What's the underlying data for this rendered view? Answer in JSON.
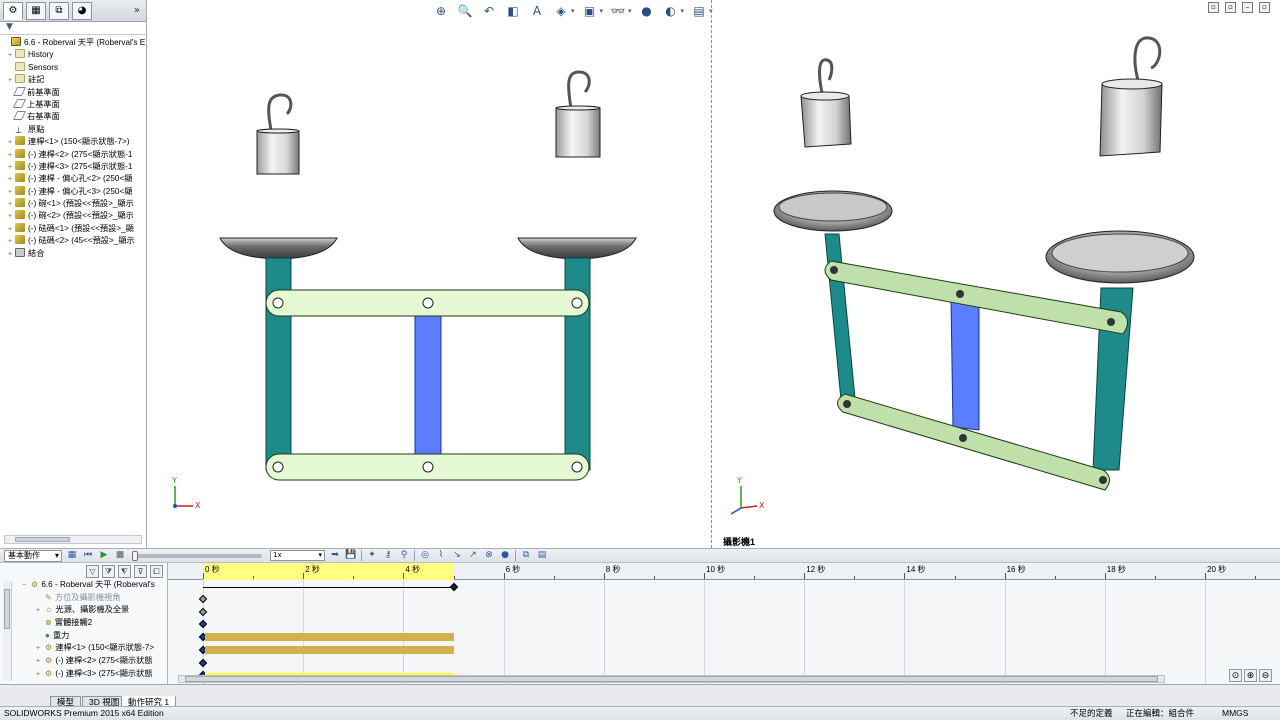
{
  "left_panel": {
    "tabs": [
      "feature-manager",
      "property-manager",
      "configuration-manager",
      "display-manager"
    ],
    "expand_glyph": "»",
    "filter_glyph": "▼",
    "tree": [
      {
        "label": "6.6 - Roberval 天平 (Roberval's E",
        "icon": "asm",
        "exp": "",
        "indent": 0
      },
      {
        "label": "History",
        "icon": "folder",
        "exp": "+",
        "indent": 1
      },
      {
        "label": "Sensors",
        "icon": "folder",
        "exp": "",
        "indent": 1
      },
      {
        "label": "註記",
        "icon": "folder",
        "exp": "+",
        "indent": 1
      },
      {
        "label": "前基準面",
        "icon": "plane",
        "exp": "",
        "indent": 1
      },
      {
        "label": "上基準面",
        "icon": "plane",
        "exp": "",
        "indent": 1
      },
      {
        "label": "右基準面",
        "icon": "plane",
        "exp": "",
        "indent": 1
      },
      {
        "label": "原點",
        "icon": "origin",
        "exp": "",
        "indent": 1
      },
      {
        "label": "連桿<1> (150<顯示狀態-7>)",
        "icon": "part",
        "exp": "+",
        "indent": 1
      },
      {
        "label": "(-) 連桿<2> (275<顯示狀態-1",
        "icon": "part",
        "exp": "+",
        "indent": 1
      },
      {
        "label": "(-) 連桿<3> (275<顯示狀態-1",
        "icon": "part",
        "exp": "+",
        "indent": 1
      },
      {
        "label": "(-) 連桿 - 偏心孔<2> (250<顯",
        "icon": "part",
        "exp": "+",
        "indent": 1
      },
      {
        "label": "(-) 連桿 - 偏心孔<3> (250<顯",
        "icon": "part",
        "exp": "+",
        "indent": 1
      },
      {
        "label": "(-) 碗<1> (預設<<預設>_顯示",
        "icon": "part",
        "exp": "+",
        "indent": 1
      },
      {
        "label": "(-) 碗<2> (預設<<預設>_顯示",
        "icon": "part",
        "exp": "+",
        "indent": 1
      },
      {
        "label": "(-) 砝碼<1> (預設<<預設>_顯",
        "icon": "part",
        "exp": "+",
        "indent": 1
      },
      {
        "label": "(-) 砝碼<2> (45<<預設>_顯示",
        "icon": "part",
        "exp": "+",
        "indent": 1
      },
      {
        "label": "結合",
        "icon": "mate",
        "exp": "+",
        "indent": 1
      }
    ]
  },
  "heads_up_toolbar": {
    "buttons": [
      {
        "name": "zoom-to-fit-icon",
        "glyph": "⊕",
        "caret": false
      },
      {
        "name": "zoom-to-area-icon",
        "glyph": "🔍",
        "caret": false
      },
      {
        "name": "previous-view-icon",
        "glyph": "↶",
        "caret": false
      },
      {
        "name": "section-view-icon",
        "glyph": "◧",
        "caret": false
      },
      {
        "name": "dynamic-annotation-icon",
        "glyph": "A",
        "caret": false
      },
      {
        "name": "view-orientation-icon",
        "glyph": "◈",
        "caret": true
      },
      {
        "name": "display-style-icon",
        "glyph": "▣",
        "caret": true
      },
      {
        "name": "hide-show-items-icon",
        "glyph": "👓",
        "caret": true
      },
      {
        "name": "edit-appearance-icon",
        "glyph": "●",
        "caret": false
      },
      {
        "name": "apply-scene-icon",
        "glyph": "◐",
        "caret": true
      },
      {
        "name": "view-settings-icon",
        "glyph": "▤",
        "caret": true
      }
    ]
  },
  "viewports": {
    "left": {
      "triad_x": "X",
      "triad_y": "Y"
    },
    "right": {
      "triad_x": "X",
      "triad_y": "Y",
      "camera_label": "攝影機1"
    }
  },
  "motion_toolbar": {
    "study_type": "基本動作",
    "speed": "1x"
  },
  "motion_tree": [
    {
      "label": "6.6 - Roberval 天平 (Roberval's",
      "exp": "−",
      "icon": "asm",
      "indent": 0
    },
    {
      "label": "方位及攝影機視角",
      "exp": "",
      "icon": "view",
      "indent": 1,
      "grey": true
    },
    {
      "label": "光源、攝影機及全景",
      "exp": "+",
      "icon": "folder",
      "indent": 1
    },
    {
      "label": "實體接觸2",
      "exp": "",
      "icon": "contact",
      "indent": 1
    },
    {
      "label": "重力",
      "exp": "",
      "icon": "gravity",
      "indent": 1
    },
    {
      "label": "連桿<1> (150<顯示狀態-7>",
      "exp": "+",
      "icon": "part",
      "indent": 1
    },
    {
      "label": "(-) 連桿<2> (275<顯示狀態",
      "exp": "+",
      "icon": "part",
      "indent": 1
    },
    {
      "label": "(-) 連桿<3> (275<顯示狀態",
      "exp": "+",
      "icon": "part",
      "indent": 1
    }
  ],
  "timeline": {
    "tick_labels": [
      "0 秒",
      "2 秒",
      "4 秒",
      "6 秒",
      "8 秒",
      "10 秒",
      "12 秒",
      "14 秒",
      "16 秒",
      "18 秒",
      "20 秒"
    ],
    "highlight_end_seconds": 5,
    "bars": [
      {
        "row": 3,
        "color": "#d2b14d"
      },
      {
        "row": 4,
        "color": "#d2b14d"
      },
      {
        "row": 6,
        "color": "#ffff33"
      },
      {
        "row": 7,
        "color": "#ffff33"
      }
    ]
  },
  "bottom_tabs": [
    "模型",
    "3D 視圖",
    "動作研究 1"
  ],
  "active_tab": "動作研究 1",
  "status": {
    "edition": "SOLIDWORKS Premium 2015 x64 Edition",
    "definition": "不足的定義",
    "editing": "正在編輯：組合件",
    "units": "MMGS"
  },
  "colors": {
    "link_green": "#e4f9d4",
    "post_teal": "#1e8a8a",
    "post_blue": "#5b7dff",
    "timeline_yellow": "#ffff80",
    "key_blue": "#1a3a8a"
  }
}
